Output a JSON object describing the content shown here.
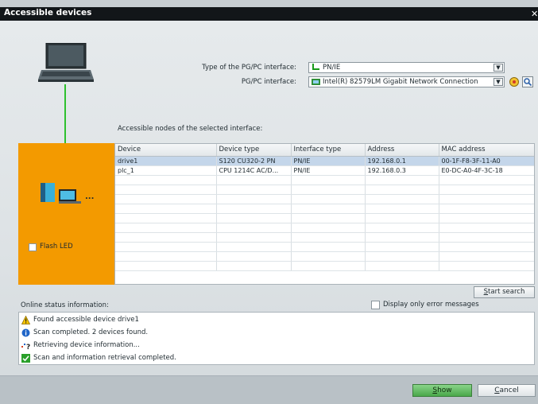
{
  "window": {
    "title": "Accessible devices"
  },
  "interface": {
    "type_label": "Type of the PG/PC interface:",
    "type_value": "PN/IE",
    "pgpc_label": "PG/PC interface:",
    "pgpc_value": "Intel(R) 82579LM Gigabit Network Connection"
  },
  "nodes": {
    "label": "Accessible nodes of the selected interface:",
    "columns": [
      "Device",
      "Device type",
      "Interface type",
      "Address",
      "MAC address"
    ],
    "rows": [
      [
        "drive1",
        "S120 CU320-2 PN",
        "PN/IE",
        "192.168.0.1",
        "00-1F-F8-3F-11-A0"
      ],
      [
        "plc_1",
        "CPU 1214C AC/D...",
        "PN/IE",
        "192.168.0.3",
        "E0-DC-A0-4F-3C-18"
      ]
    ],
    "flash_led_label": "Flash LED",
    "more_indicator": "..."
  },
  "search": {
    "start_label_u": "S",
    "start_label_rest": "tart search"
  },
  "status": {
    "header": "Online status information:",
    "errors_only_label": "Display only error messages",
    "messages": [
      {
        "icon": "warning-icon",
        "text": "Found accessible device drive1"
      },
      {
        "icon": "info-icon",
        "text": "Scan completed. 2 devices found."
      },
      {
        "icon": "retrieving-icon",
        "text": "Retrieving device information..."
      },
      {
        "icon": "check-icon",
        "text": "Scan and information retrieval completed."
      }
    ]
  },
  "buttons": {
    "show_u": "S",
    "show_rest": "how",
    "cancel_u": "C",
    "cancel_rest": "ancel"
  },
  "colors": {
    "accent_orange": "#f39a00",
    "selection": "#c4d6ea",
    "link_green": "#2ec12e",
    "show_green": "#4aa84a"
  }
}
